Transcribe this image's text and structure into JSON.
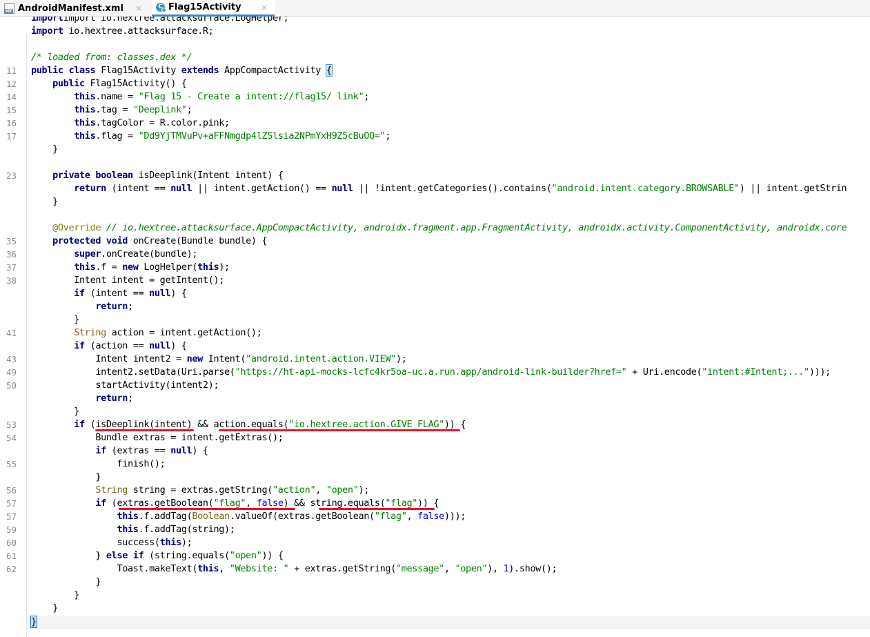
{
  "tabs": [
    {
      "label": "AndroidManifest.xml",
      "icon": "manifest-file-icon",
      "close": "×"
    },
    {
      "label": "Flag15Activity",
      "icon": "java-class-icon",
      "close": "×"
    }
  ],
  "icon_text": {
    "mf": "MF",
    "c": "C"
  },
  "lines": {
    "l0": {
      "num": "",
      "code": "import io.hextree.attacksurface.LogHelper;"
    },
    "l1": {
      "num": "",
      "kw1": "import",
      "code": " io.hextree.attacksurface.R;"
    },
    "l3": {
      "num": "",
      "comment": "/* loaded from: classes.dex */"
    },
    "l4": {
      "num": "11",
      "kw1": "public class",
      "t1": " Flag15Activity ",
      "kw2": "extends",
      "t2": " AppCompactActivity ",
      "brace": "{"
    },
    "l5": {
      "num": "12",
      "kw1": "public",
      "t1": " Flag15Activity() {"
    },
    "l6": {
      "num": "14",
      "kw1": "this",
      "t1": ".name = ",
      "s1": "\"Flag 15 - Create a intent://flag15/ link\"",
      "t2": ";"
    },
    "l7": {
      "num": "15",
      "kw1": "this",
      "t1": ".tag = ",
      "s1": "\"Deeplink\"",
      "t2": ";"
    },
    "l8": {
      "num": "16",
      "kw1": "this",
      "t1": ".tagColor = R.color.pink;"
    },
    "l9": {
      "num": "17",
      "kw1": "this",
      "t1": ".flag = ",
      "s1": "\"Dd9YjTMVuPv+aFFNmgdp4lZSlsia2NPmYxH9Z5cBuOQ=\"",
      "t2": ";"
    },
    "l10": {
      "num": "",
      "t1": "}"
    },
    "l12": {
      "num": "23",
      "kw1": "private boolean",
      "t1": " isDeeplink(Intent intent) {"
    },
    "l13": {
      "num": "",
      "kw1": "return",
      "t1": " (intent == ",
      "kw2": "null",
      "t2": " || intent.getAction() == ",
      "kw3": "null",
      "t3": " || !intent.getCategories().contains(",
      "s1": "\"android.intent.category.BROWSABLE\"",
      "t4": ") || intent.getStrin"
    },
    "l14": {
      "num": "",
      "t1": "}"
    },
    "l16": {
      "num": "",
      "an": "@Override",
      "cm": " // io.hextree.attacksurface.AppCompactActivity, androidx.fragment.app.FragmentActivity, androidx.activity.ComponentActivity, androidx.core"
    },
    "l17": {
      "num": "35",
      "kw1": "protected void",
      "t1": " onCreate(Bundle bundle) {"
    },
    "l18": {
      "num": "36",
      "kw1": "super",
      "t1": ".onCreate(bundle);"
    },
    "l19": {
      "num": "37",
      "kw1": "this",
      "t1": ".f = ",
      "kw2": "new",
      "t2": " LogHelper(",
      "kw3": "this",
      "t3": ");"
    },
    "l20": {
      "num": "38",
      "t1": "Intent intent = getIntent();"
    },
    "l21": {
      "num": "",
      "kw1": "if",
      "t1": " (intent == ",
      "kw2": "null",
      "t2": ") {"
    },
    "l22": {
      "num": "",
      "kw1": "return",
      "t1": ";"
    },
    "l23": {
      "num": "",
      "t1": "}"
    },
    "l24": {
      "num": "41",
      "ty": "String",
      "t1": " action = intent.getAction();"
    },
    "l25": {
      "num": "",
      "kw1": "if",
      "t1": " (action == ",
      "kw2": "null",
      "t2": ") {"
    },
    "l26": {
      "num": "43",
      "t1": "Intent intent2 = ",
      "kw1": "new",
      "t2": " Intent(",
      "s1": "\"android.intent.action.VIEW\"",
      "t3": ");"
    },
    "l27": {
      "num": "49",
      "t1": "intent2.setData(Uri.parse(",
      "s1": "\"https://ht-api-mocks-lcfc4kr5oa-uc.a.run.app/android-link-builder?href=\"",
      "t2": " + Uri.encode(",
      "s2": "\"intent:#Intent;...\"",
      "t3": ")));"
    },
    "l28": {
      "num": "50",
      "t1": "startActivity(intent2);"
    },
    "l29": {
      "num": "",
      "kw1": "return",
      "t1": ";"
    },
    "l30": {
      "num": "",
      "t1": "}"
    },
    "l31": {
      "num": "53",
      "kw1": "if",
      "t1": " (isDeeplink(intent) && action.equals(",
      "s1": "\"io.hextree.action.GIVE_FLAG\"",
      "t2": ")) {"
    },
    "l32": {
      "num": "54",
      "t1": "Bundle extras = intent.getExtras();"
    },
    "l33": {
      "num": "",
      "kw1": "if",
      "t1": " (extras == ",
      "kw2": "null",
      "t2": ") {"
    },
    "l34": {
      "num": "55",
      "t1": "finish();"
    },
    "l35": {
      "num": "",
      "t1": "}"
    },
    "l36": {
      "num": "56",
      "ty": "String",
      "t1": " string = extras.getString(",
      "s1": "\"action\"",
      "t2": ", ",
      "s2": "\"open\"",
      "t3": ");"
    },
    "l37": {
      "num": "57",
      "kw1": "if",
      "t1": " (extras.getBoolean(",
      "s1": "\"flag\"",
      "t2": ", ",
      "fl": "false",
      "t3": ") && string.equals(",
      "s2": "\"flag\"",
      "t4": ")) {"
    },
    "l38": {
      "num": "57",
      "kw1": "this",
      "t1": ".f.addTag(",
      "ty": "Boolean",
      "t2": ".valueOf(extras.getBoolean(",
      "s1": "\"flag\"",
      "t3": ", ",
      "fl": "false",
      "t4": ")));"
    },
    "l39": {
      "num": "59",
      "kw1": "this",
      "t1": ".f.addTag(string);"
    },
    "l40": {
      "num": "60",
      "t1": "success(",
      "kw1": "this",
      "t2": ");"
    },
    "l41": {
      "num": "61",
      "t0": "} ",
      "kw1": "else if",
      "t1": " (string.equals(",
      "s1": "\"open\"",
      "t2": ")) {"
    },
    "l42": {
      "num": "62",
      "t1": "Toast.makeText(",
      "kw1": "this",
      "t2": ", ",
      "s1": "\"Website: \"",
      "t3": " + extras.getString(",
      "s2": "\"message\"",
      "t4": ", ",
      "s3": "\"open\"",
      "t5": "), ",
      "n1": "1",
      "t6": ").show();"
    },
    "l43": {
      "num": "",
      "t1": "}"
    },
    "l44": {
      "num": "",
      "t1": "}"
    },
    "l45": {
      "num": "",
      "t1": "}"
    },
    "l46": {
      "num": "",
      "brace": "}"
    }
  },
  "colors": {
    "keyword": "#000080",
    "string": "#008000",
    "comment": "#808080",
    "underline": "#e8132b"
  }
}
